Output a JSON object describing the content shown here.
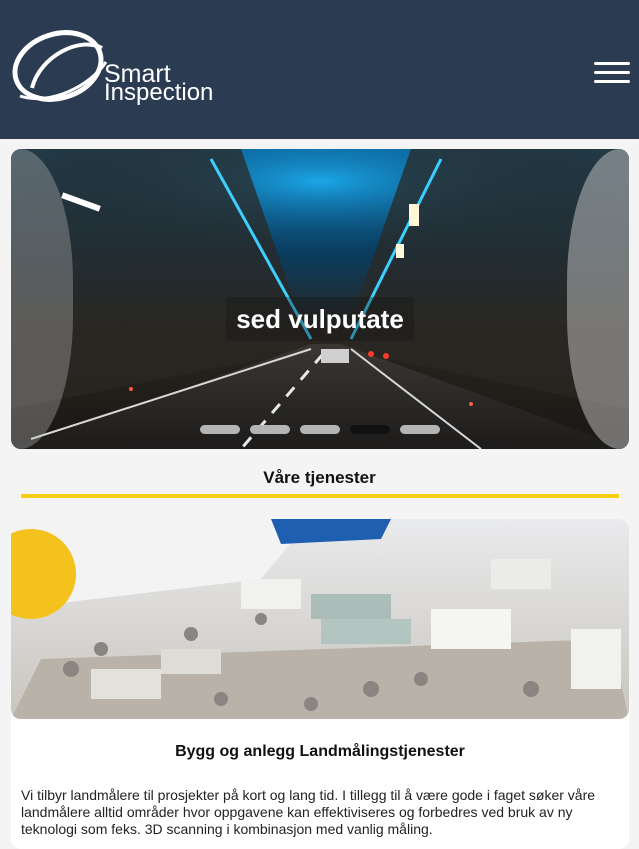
{
  "header": {
    "logo_word_1": "Smart",
    "logo_word_2": "Inspection",
    "menu_icon": "hamburger-menu-icon",
    "background_color": "#2a3b52"
  },
  "slider": {
    "caption": "sed vulputate",
    "slide_count": 5,
    "active_slide": 4
  },
  "services": {
    "title": "Våre tjenester",
    "accent_color": "#f2cf15"
  },
  "card": {
    "title": "Bygg og anlegg Landmålingstjenester",
    "text": "Vi tilbyr landmålere til prosjekter på kort og lang tid. I tillegg til å være gode i faget søker våre landmålere alltid områder hvor oppgavene kan effektiviseres og forbedres ved bruk av ny teknologi som feks. 3D scanning i kombinasjon med vanlig måling."
  }
}
